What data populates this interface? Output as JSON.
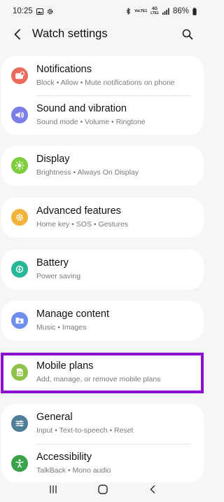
{
  "status_bar": {
    "time": "10:25",
    "volte_label": "VoLTE1",
    "network_label": "4G",
    "lte_label": "LTE1",
    "battery_percent": "86%"
  },
  "header": {
    "title": "Watch settings"
  },
  "settings": [
    {
      "title": "Notifications",
      "subtitle": "Block • Allow • Mute notifications on phone",
      "icon": "notifications-icon",
      "color": "#ef6b5b"
    },
    {
      "title": "Sound and vibration",
      "subtitle": "Sound mode • Volume • Ringtone",
      "icon": "sound-icon",
      "color": "#7b7ee8"
    },
    {
      "title": "Display",
      "subtitle": "Brightness • Always On Display",
      "icon": "display-icon",
      "color": "#7ccf3a"
    },
    {
      "title": "Advanced features",
      "subtitle": "Home key • SOS • Gestures",
      "icon": "advanced-features-icon",
      "color": "#f2b33a"
    },
    {
      "title": "Battery",
      "subtitle": "Power saving",
      "icon": "battery-icon",
      "color": "#27b796"
    },
    {
      "title": "Manage content",
      "subtitle": "Music • Images",
      "icon": "manage-content-icon",
      "color": "#6e8df0"
    },
    {
      "title": "Mobile plans",
      "subtitle": "Add, manage, or remove mobile plans",
      "icon": "mobile-plans-icon",
      "color": "#8ec24a"
    },
    {
      "title": "General",
      "subtitle": "Input • Text-to-speech • Reset",
      "icon": "general-icon",
      "color": "#4f7c96"
    },
    {
      "title": "Accessibility",
      "subtitle": "TalkBack • Mono audio",
      "icon": "accessibility-icon",
      "color": "#3aa34a"
    }
  ],
  "highlight_color": "#8a0fd0",
  "nav": {
    "recents_icon": "recents-icon",
    "home_icon": "home-icon",
    "back_icon": "back-icon"
  }
}
